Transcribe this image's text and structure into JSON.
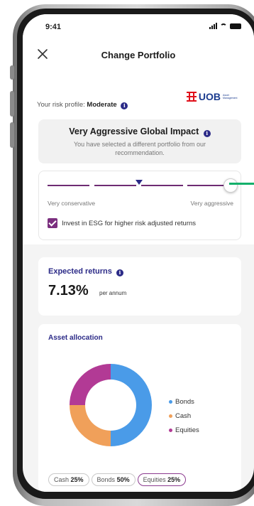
{
  "status_bar": {
    "time": "9:41"
  },
  "header": {
    "title": "Change Portfolio"
  },
  "risk_profile": {
    "label": "Your risk profile:",
    "value": "Moderate",
    "info_icon": "i"
  },
  "brand": {
    "name": "UOB",
    "subtitle": "Asset Management",
    "color": "#1a3b8f",
    "mark_color": "#e0101b"
  },
  "portfolio": {
    "name": "Very Aggressive Global Impact",
    "info_icon": "i",
    "note": "You have selected a different portfolio from our recommendation."
  },
  "risk_slider": {
    "min_label": "Very conservative",
    "max_label": "Very aggressive",
    "recommended_level": 0.5,
    "selected_level": 1.0
  },
  "esg_option": {
    "label": "Invest in ESG for higher risk adjusted returns",
    "checked": true
  },
  "expected_returns": {
    "title": "Expected returns",
    "info_icon": "i",
    "value": "7.13%",
    "unit": "per annum"
  },
  "asset_allocation": {
    "title": "Asset allocation",
    "chart_data": {
      "type": "pie",
      "categories": [
        "Bonds",
        "Cash",
        "Equities"
      ],
      "values": [
        50,
        25,
        25
      ],
      "colors": [
        "#4a9be8",
        "#f0a05a",
        "#b23a95"
      ]
    },
    "pills": [
      {
        "label": "Cash",
        "value": "25%",
        "active": false
      },
      {
        "label": "Bonds",
        "value": "50%",
        "active": false
      },
      {
        "label": "Equities",
        "value": "25%",
        "active": true
      }
    ]
  },
  "colors": {
    "primary": "#2b2a87",
    "accent": "#7b2f7f",
    "connector": "#14b06b"
  }
}
